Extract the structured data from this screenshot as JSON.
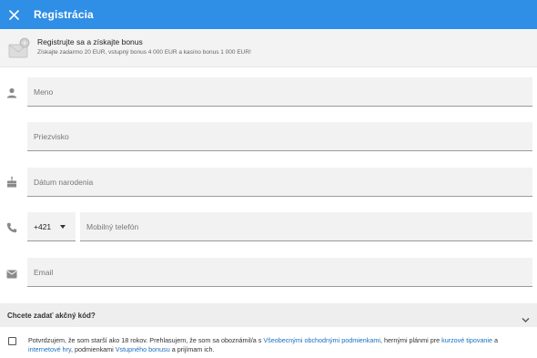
{
  "header": {
    "title": "Registrácia",
    "close_icon": "close-icon",
    "background_color": "#2f8ee5"
  },
  "promo": {
    "headline": "Registrujte sa a získajte bonus",
    "subtext": "Získajte zadarmo 20 EUR, vstupný bonus 4 000 EUR a kasíno bonus 1 000 EUR!",
    "icon": "gift-envelope-icon"
  },
  "form": {
    "first_name": {
      "placeholder": "Meno",
      "value": "",
      "icon": "person-icon"
    },
    "last_name": {
      "placeholder": "Priezvisko",
      "value": ""
    },
    "birth_date": {
      "placeholder": "Dátum narodenia",
      "value": "",
      "icon": "cake-icon"
    },
    "phone": {
      "prefix": "+421",
      "placeholder": "Mobilný telefón",
      "value": "",
      "icon": "phone-icon"
    },
    "email": {
      "placeholder": "Email",
      "value": "",
      "icon": "mail-icon"
    }
  },
  "promo_code": {
    "label": "Chcete zadať akčný kód?",
    "icon": "chevron-down-icon"
  },
  "consent": {
    "text_1": "Potvrdzujem, že som starší ako 18 rokov. Prehlasujem, že som sa oboznámil/a s ",
    "link_terms": "Všeobecnými obchodnými podmienkami",
    "text_2": ", hernými plánmi pre ",
    "link_course": "kurzové tipovanie",
    "text_3": " a ",
    "link_games": "internetové hry",
    "text_4": ", podmienkami ",
    "link_bonus": "Vstupného bonusu",
    "text_5": " a prijímam ich.",
    "checked": false,
    "link_color": "#1a6fc0"
  }
}
